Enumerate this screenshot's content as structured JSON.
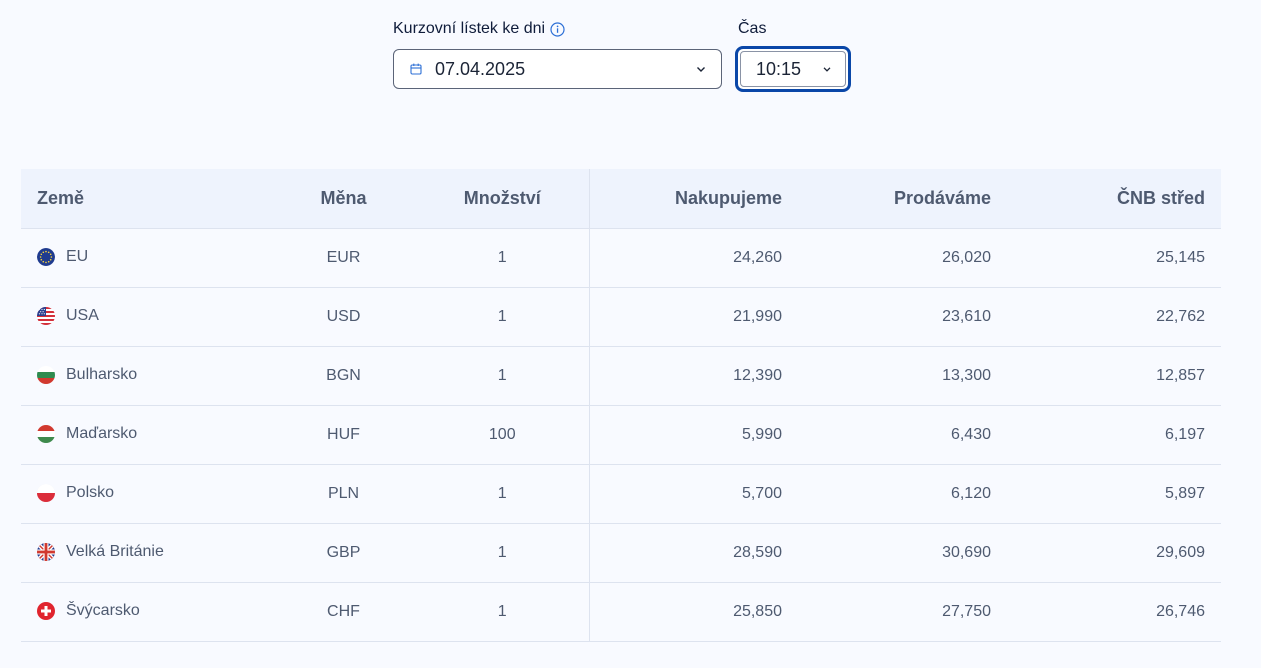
{
  "filters": {
    "date_label": "Kurzovní lístek ke dni",
    "date_value": "07.04.2025",
    "time_label": "Čas",
    "time_value": "10:15"
  },
  "table": {
    "headers": {
      "country": "Země",
      "currency": "Měna",
      "amount": "Množství",
      "buy": "Nakupujeme",
      "sell": "Prodáváme",
      "mid": "ČNB střed"
    },
    "rows": [
      {
        "flag": "eu-flag-icon",
        "country": "EU",
        "currency": "EUR",
        "amount": "1",
        "buy": "24,260",
        "sell": "26,020",
        "mid": "25,145"
      },
      {
        "flag": "us-flag-icon",
        "country": "USA",
        "currency": "USD",
        "amount": "1",
        "buy": "21,990",
        "sell": "23,610",
        "mid": "22,762"
      },
      {
        "flag": "bg-flag-icon",
        "country": "Bulharsko",
        "currency": "BGN",
        "amount": "1",
        "buy": "12,390",
        "sell": "13,300",
        "mid": "12,857"
      },
      {
        "flag": "hu-flag-icon",
        "country": "Maďarsko",
        "currency": "HUF",
        "amount": "100",
        "buy": "5,990",
        "sell": "6,430",
        "mid": "6,197"
      },
      {
        "flag": "pl-flag-icon",
        "country": "Polsko",
        "currency": "PLN",
        "amount": "1",
        "buy": "5,700",
        "sell": "6,120",
        "mid": "5,897"
      },
      {
        "flag": "gb-flag-icon",
        "country": "Velká Británie",
        "currency": "GBP",
        "amount": "1",
        "buy": "28,590",
        "sell": "30,690",
        "mid": "29,609"
      },
      {
        "flag": "ch-flag-icon",
        "country": "Švýcarsko",
        "currency": "CHF",
        "amount": "1",
        "buy": "25,850",
        "sell": "27,750",
        "mid": "26,746"
      }
    ]
  },
  "colors": {
    "header_bg": "#eef3fd",
    "focus_ring": "#0a47a8",
    "text_muted": "#4e5a70"
  }
}
